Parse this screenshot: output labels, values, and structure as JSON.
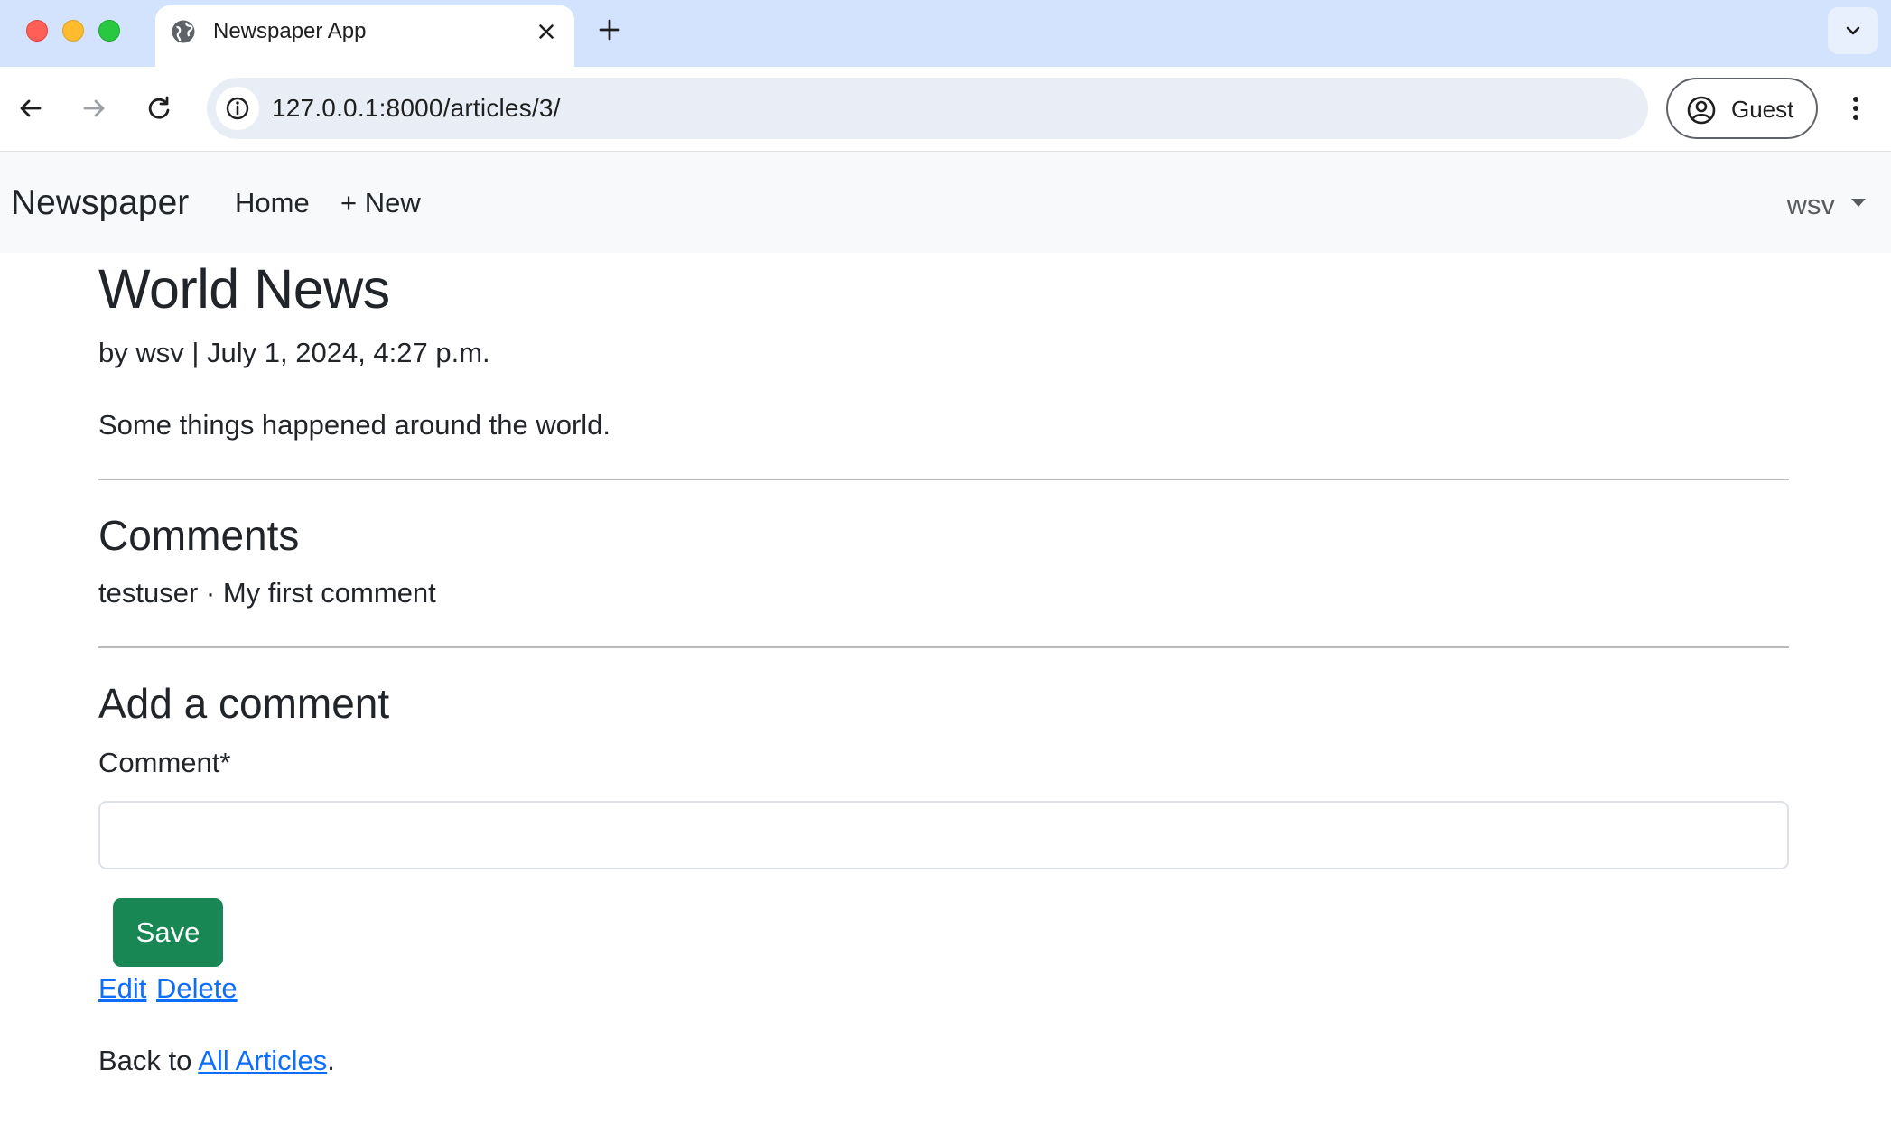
{
  "browser": {
    "tab_title": "Newspaper App",
    "url": "127.0.0.1:8000/articles/3/",
    "profile_label": "Guest"
  },
  "navbar": {
    "brand": "Newspaper",
    "links": [
      {
        "label": "Home"
      },
      {
        "label": "+ New"
      }
    ],
    "user": "wsv"
  },
  "article": {
    "title": "World News",
    "byline": "by wsv | July 1, 2024, 4:27 p.m.",
    "body": "Some things happened around the world."
  },
  "comments": {
    "heading": "Comments",
    "items": [
      {
        "text": "testuser · My first comment"
      }
    ]
  },
  "comment_form": {
    "heading": "Add a comment",
    "field_label": "Comment*",
    "field_value": "",
    "submit_label": "Save"
  },
  "actions": {
    "edit_label": "Edit",
    "delete_label": "Delete"
  },
  "footer": {
    "prefix": "Back to ",
    "link_label": "All Articles",
    "suffix": "."
  },
  "colors": {
    "tabstrip_bg": "#d3e3fd",
    "navbar_bg": "#f8f9fa",
    "save_button": "#198754",
    "link": "#0d6efd"
  }
}
